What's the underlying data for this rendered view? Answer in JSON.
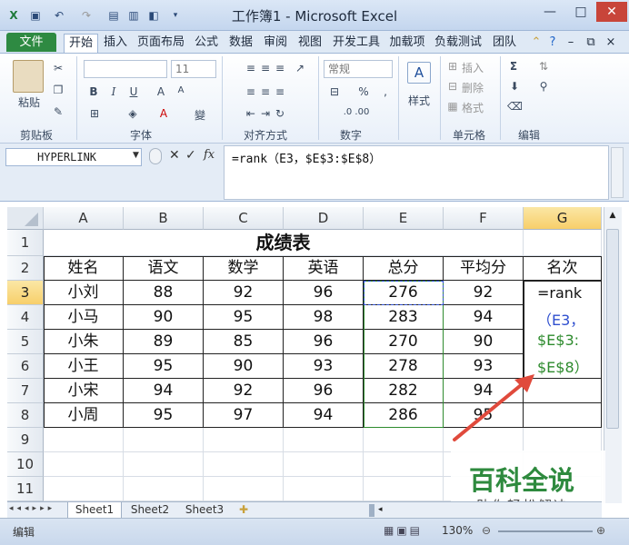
{
  "window": {
    "title": "工作簿1 - Microsoft Excel",
    "minimize": "—",
    "restore": "□",
    "close": "✕"
  },
  "quick_access": [
    "save-icon",
    "undo-icon",
    "redo-icon",
    "customize-icon"
  ],
  "ribbon": {
    "file_tab": "文件",
    "tabs": [
      "开始",
      "插入",
      "页面布局",
      "公式",
      "数据",
      "审阅",
      "视图",
      "开发工具",
      "加载项",
      "负载测试",
      "团队"
    ],
    "active_tab": "开始",
    "groups": {
      "clipboard": {
        "label": "剪贴板",
        "paste": "粘贴"
      },
      "font": {
        "label": "字体",
        "font_size": "11",
        "bold": "B",
        "italic": "I",
        "underline": "U",
        "grow": "A",
        "change_case": "變"
      },
      "alignment": {
        "label": "对齐方式"
      },
      "number": {
        "label": "数字",
        "format": "常规",
        "percent": "%"
      },
      "styles": {
        "label": "样式"
      },
      "cells": {
        "label": "单元格",
        "insert": "插入",
        "delete": "删除",
        "format": "格式"
      },
      "editing": {
        "label": "编辑",
        "sum": "Σ"
      }
    }
  },
  "formula_bar": {
    "name_box": "HYPERLINK",
    "fx": "fx",
    "formula": "=rank（E3，$E$3:$E$8）"
  },
  "sheet": {
    "columns": [
      "A",
      "B",
      "C",
      "D",
      "E",
      "F",
      "G"
    ],
    "row_numbers": [
      "1",
      "2",
      "3",
      "4",
      "5",
      "6",
      "7",
      "8",
      "9",
      "10",
      "11"
    ],
    "title": "成绩表",
    "headers": [
      "姓名",
      "语文",
      "数学",
      "英语",
      "总分",
      "平均分",
      "名次"
    ],
    "rows": [
      [
        "小刘",
        "88",
        "92",
        "96",
        "276",
        "92"
      ],
      [
        "小马",
        "90",
        "95",
        "98",
        "283",
        "94"
      ],
      [
        "小朱",
        "89",
        "85",
        "96",
        "270",
        "90"
      ],
      [
        "小王",
        "95",
        "90",
        "93",
        "278",
        "93"
      ],
      [
        "小宋",
        "94",
        "92",
        "96",
        "282",
        "94"
      ],
      [
        "小周",
        "95",
        "97",
        "94",
        "286",
        "95"
      ]
    ],
    "editing_cell_lines": [
      "=rank",
      "（E3，",
      "$E$3:",
      "$E$8）"
    ]
  },
  "sheet_tabs": [
    "Sheet1",
    "Sheet2",
    "Sheet3"
  ],
  "status": {
    "mode": "编辑",
    "zoom": "130%"
  },
  "watermark": {
    "main": "百科全说",
    "sub": "助你轻松解决"
  },
  "colors": {
    "file_tab": "#2e8a42",
    "ref_blue": "#2f4fcf",
    "ref_green": "#2e8b2e",
    "arrow": "#e04a3c"
  }
}
